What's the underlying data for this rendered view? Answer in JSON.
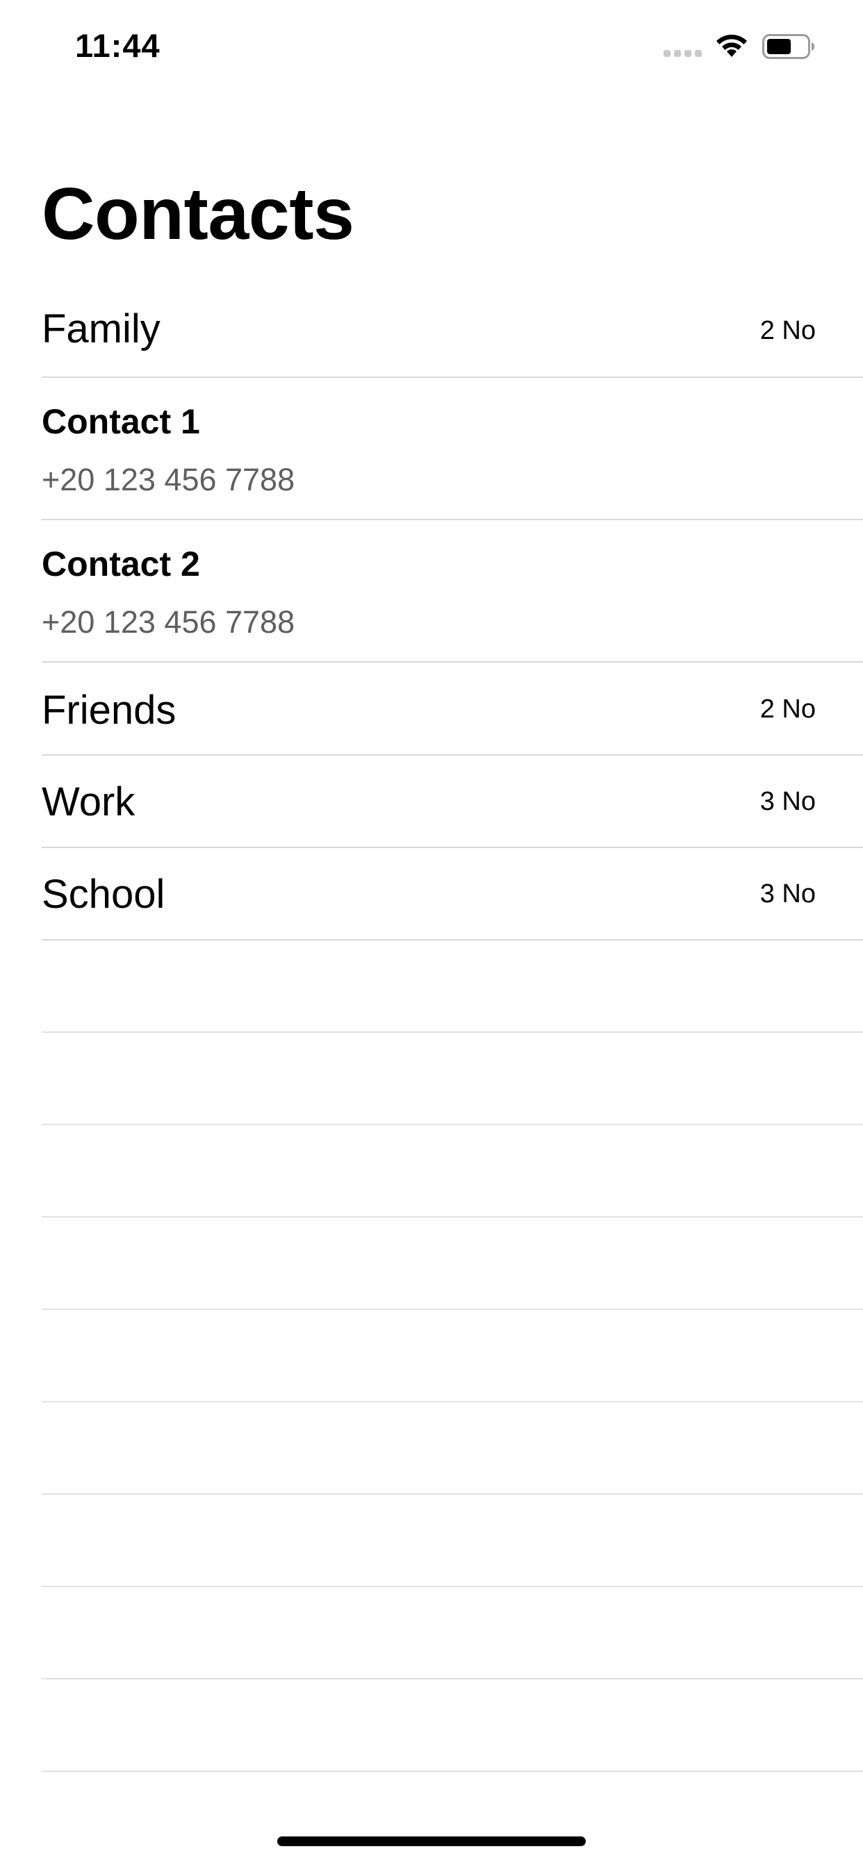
{
  "status_bar": {
    "time": "11:44",
    "icons": [
      "signal-icon",
      "wifi-icon",
      "battery-icon"
    ]
  },
  "title": "Contacts",
  "groups": [
    {
      "label": "Family",
      "count": "2 No",
      "contacts": [
        {
          "name": "Contact 1",
          "phone": "+20 123 456 7788"
        },
        {
          "name": "Contact 2",
          "phone": "+20 123 456 7788"
        }
      ]
    },
    {
      "label": "Friends",
      "count": "2 No",
      "contacts": []
    },
    {
      "label": "Work",
      "count": "3 No",
      "contacts": []
    },
    {
      "label": "School",
      "count": "3 No",
      "contacts": []
    }
  ],
  "colors": {
    "background": "#ffffff",
    "text": "#000000",
    "secondary_text": "#5f5f5f",
    "separator": "#d9d9dd"
  }
}
